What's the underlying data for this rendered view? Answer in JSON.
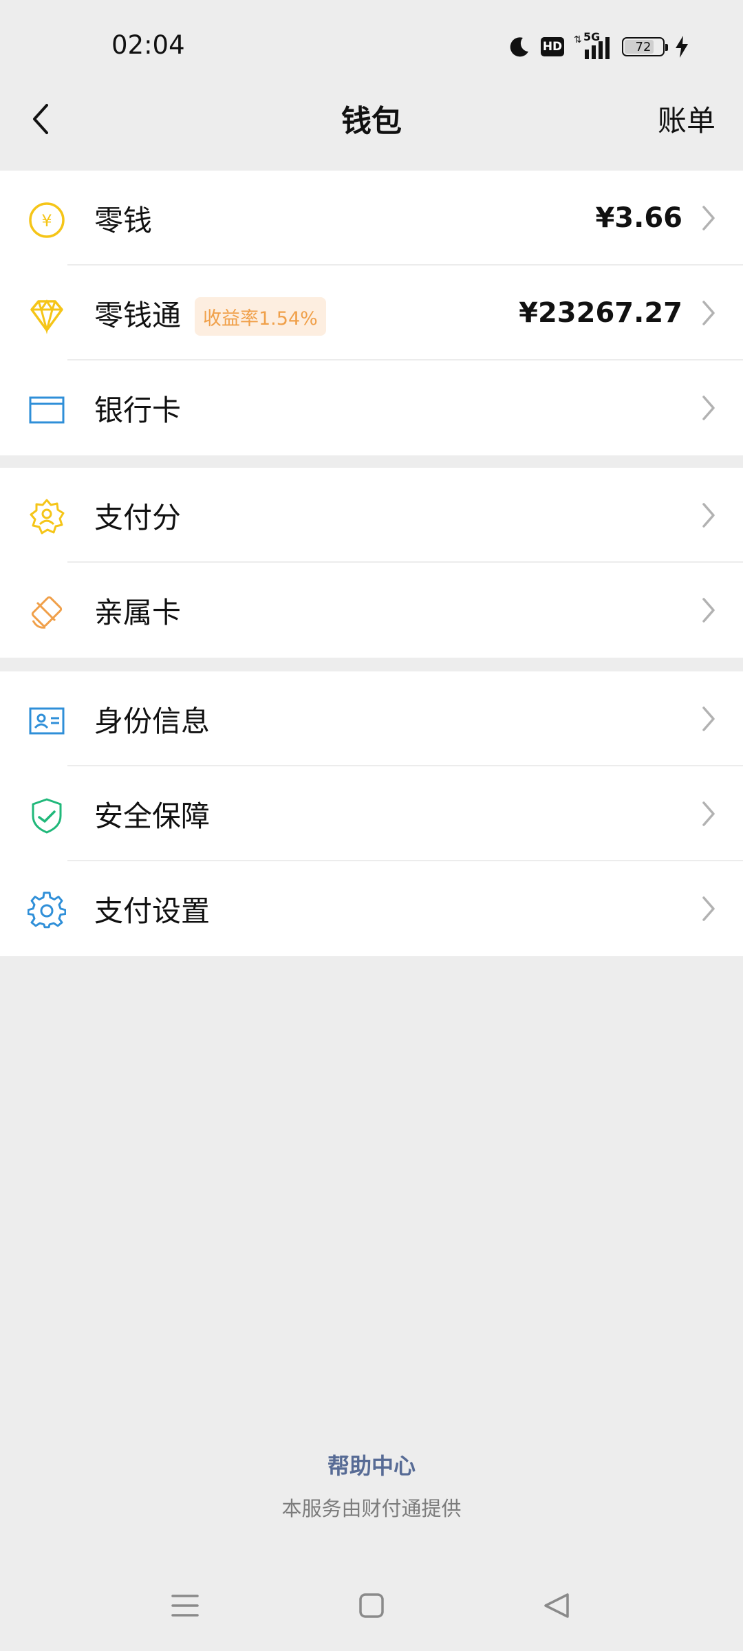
{
  "status_bar": {
    "time": "02:04",
    "network_label": "5G",
    "hd_label": "HD",
    "battery": "72",
    "icons": [
      "moon-icon",
      "hd-icon",
      "signal-icon",
      "battery-icon",
      "charging-icon"
    ]
  },
  "nav": {
    "title": "钱包",
    "right_action": "账单",
    "back_icon": "back-arrow-icon"
  },
  "groups": [
    {
      "items": [
        {
          "label": "零钱",
          "value": "¥3.66",
          "icon": "yuan-coin-icon",
          "color": "#f5c518"
        },
        {
          "label": "零钱通",
          "badge": "收益率1.54%",
          "value": "¥23267.27",
          "icon": "diamond-icon",
          "color": "#f5c518"
        },
        {
          "label": "银行卡",
          "icon": "bank-card-icon",
          "color": "#2f8fd8"
        }
      ]
    },
    {
      "items": [
        {
          "label": "支付分",
          "icon": "pay-score-icon",
          "color": "#f5c518"
        },
        {
          "label": "亲属卡",
          "icon": "family-card-icon",
          "color": "#f0a04a"
        }
      ]
    },
    {
      "items": [
        {
          "label": "身份信息",
          "icon": "id-card-icon",
          "color": "#2f8fd8"
        },
        {
          "label": "安全保障",
          "icon": "shield-check-icon",
          "color": "#20b87a"
        },
        {
          "label": "支付设置",
          "icon": "gear-icon",
          "color": "#2f8fd8"
        }
      ]
    }
  ],
  "footer": {
    "help": "帮助中心",
    "note": "本服务由财付通提供"
  },
  "system_nav": [
    "menu-icon",
    "home-square-icon",
    "back-triangle-icon"
  ]
}
